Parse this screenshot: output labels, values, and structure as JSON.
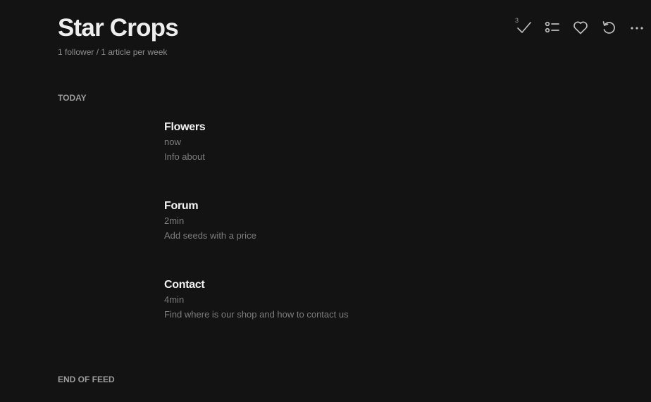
{
  "feed": {
    "title": "Star Crops",
    "meta": "1 follower / 1 article per week"
  },
  "toolbar": {
    "mark_read_count": "3",
    "icons": [
      "check-icon",
      "list-view-icon",
      "heart-icon",
      "refresh-icon",
      "more-icon"
    ]
  },
  "sections": {
    "today": "TODAY",
    "end": "END OF FEED"
  },
  "entries": [
    {
      "title": "Flowers",
      "age": "now",
      "summary": "Info about"
    },
    {
      "title": "Forum",
      "age": "2min",
      "summary": "Add seeds with a price"
    },
    {
      "title": "Contact",
      "age": "4min",
      "summary": "Find where is our shop and how to contact us"
    }
  ]
}
